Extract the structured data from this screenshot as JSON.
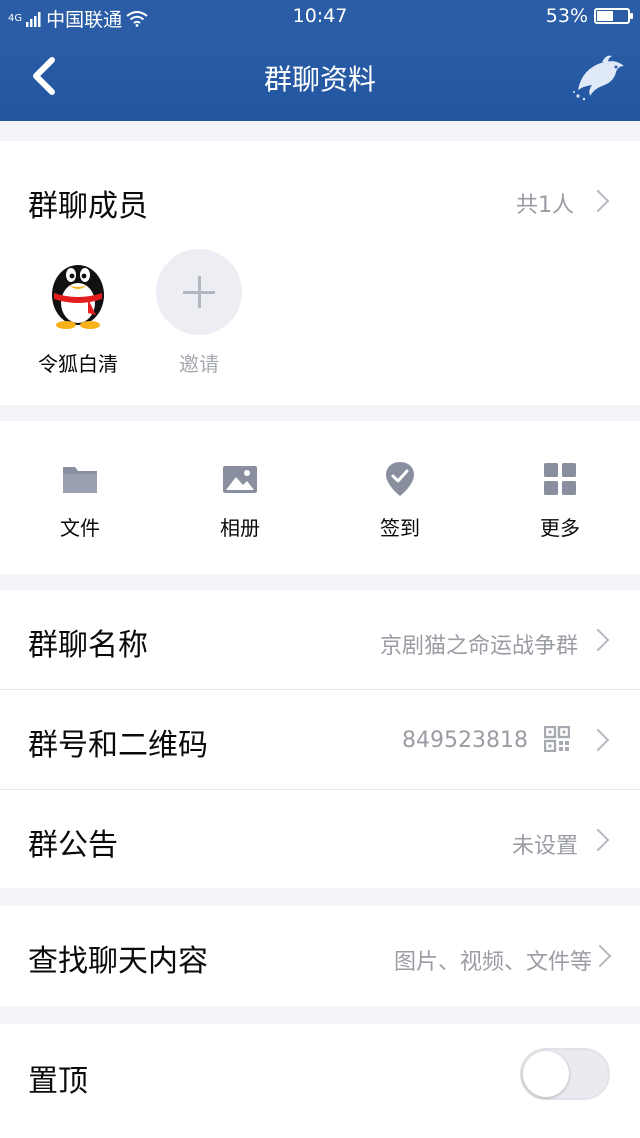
{
  "status_bar": {
    "network": "4G",
    "carrier": "中国联通",
    "time": "10:47",
    "battery": "53%",
    "battery_level": 0.53
  },
  "nav": {
    "title": "群聊资料",
    "back_icon": "chevron-left-icon",
    "logo_icon": "dolphin-icon"
  },
  "members": {
    "title": "群聊成员",
    "count": "共1人",
    "list": [
      {
        "name": "令狐白清",
        "avatar_icon": "qq-penguin-icon"
      }
    ],
    "invite_label": "邀请"
  },
  "actions": [
    {
      "label": "文件",
      "icon": "folder-icon"
    },
    {
      "label": "相册",
      "icon": "image-icon"
    },
    {
      "label": "签到",
      "icon": "location-check-icon"
    },
    {
      "label": "更多",
      "icon": "grid-icon"
    }
  ],
  "rows": {
    "group_name": {
      "title": "群聊名称",
      "value": "京剧猫之命运战争群"
    },
    "group_number": {
      "title": "群号和二维码",
      "value": "849523818",
      "icon": "qr-code-icon"
    },
    "announcement": {
      "title": "群公告",
      "value": "未设置"
    },
    "search": {
      "title": "查找聊天内容",
      "value": "图片、视频、文件等"
    },
    "pin": {
      "title": "置顶",
      "enabled": false
    }
  },
  "colors": {
    "header_blue": "#2a5da6",
    "secondary_text": "#9a9da4",
    "icon_gray": "#8a8fa0"
  }
}
